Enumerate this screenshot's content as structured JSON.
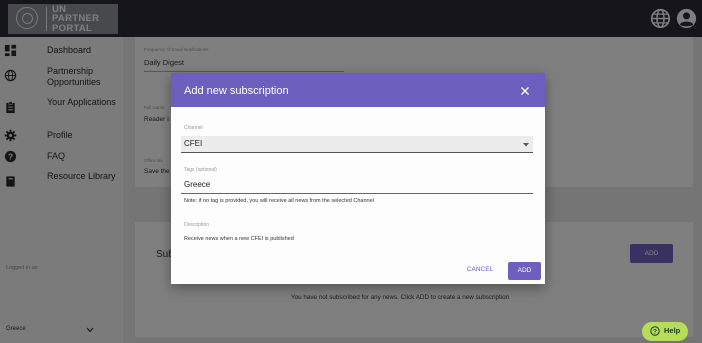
{
  "header": {
    "logo_lines": [
      "UN",
      "PARTNER",
      "PORTAL"
    ],
    "language_icon": "globe-icon",
    "account_icon": "user-circle-icon"
  },
  "sidebar": {
    "items": [
      {
        "label": "Dashboard",
        "icon": "dashboard-icon"
      },
      {
        "label": "Partnership Opportunities",
        "icon": "globe-icon"
      },
      {
        "label": "Your Applications",
        "icon": "clipboard-icon"
      },
      {
        "label": "Profile",
        "icon": "gear-icon"
      },
      {
        "label": "FAQ",
        "icon": "help-circle-icon"
      },
      {
        "label": "Resource Library",
        "icon": "book-icon"
      }
    ],
    "logged_in_label": "Logged in as:",
    "country": "Greece"
  },
  "background": {
    "frequency_label": "Frequency of Email Notifications",
    "frequency_value": "Daily Digest",
    "full_name_label": "Full Name",
    "full_name_value": "Reader I",
    "office_label": "Office Na",
    "office_value": "Save the",
    "subscriptions_title": "Sub",
    "add_label": "ADD",
    "empty_message": "You have not subscribed for any news. Click ADD to create a new subscription"
  },
  "modal": {
    "title": "Add new subscription",
    "channel_label": "Channel",
    "channel_value": "CFEI",
    "tags_label": "Tags (optional)",
    "tags_value": "Greece",
    "note": "Note: if no tag is provided, you will receive all news from the selected Channel",
    "description_label": "Description",
    "description_value": "Receive news when a new CFEI is published",
    "cancel_label": "CANCEL",
    "add_label": "ADD"
  },
  "help": {
    "label": "Help"
  },
  "colors": {
    "accent": "#6c5fbd",
    "topbar": "#2a2a35",
    "help": "#b5dc5b"
  }
}
